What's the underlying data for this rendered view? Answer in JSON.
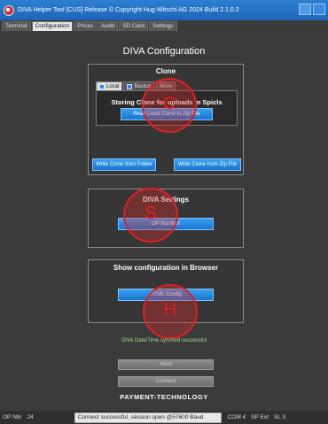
{
  "window": {
    "title": "DIVA Helper Tool  [CUS]  Release   © Copyright Hug-Witschi AG 2024 Build 2.1.0.2"
  },
  "tabs": [
    "Terminal",
    "Configuration",
    "Prices",
    "Audit",
    "SD Card",
    "Settings"
  ],
  "page_title": "DIVA Configuration",
  "clone": {
    "title": "Clone",
    "tabs": [
      "Local",
      "Backup",
      "More"
    ],
    "panel_title": "Storing Clone for uploads in Spicls",
    "read_button": "Read Local Clone to Zip File",
    "write_folder_button": "Write Clone from Folder",
    "write_zip_button": "Write Clone from Zip File"
  },
  "settings": {
    "title": "DIVA Settings",
    "op_button": "OP Number"
  },
  "browser": {
    "title": "Show configuration in Browser",
    "html_button": "HTML Config"
  },
  "markers": {
    "c": "C",
    "s": "S",
    "h": "H"
  },
  "status_message": "DIVA Date/Time synched successful",
  "abort_button": "Abort",
  "connect_button": "Connect",
  "brand": "PAYMENT-TECHNOLOGY",
  "statusbar": {
    "op_label": "OP Nbr",
    "op_value": "24",
    "connection": "Connect successful, session open @57600 Baud",
    "com": "COM 4",
    "sp": "SP Ext",
    "sl": "SL 3"
  },
  "colors": {
    "titlebar": "#1e64b6",
    "button_blue": "#1576d0",
    "marker_red": "#e02020",
    "status_green": "#9fe08a"
  }
}
